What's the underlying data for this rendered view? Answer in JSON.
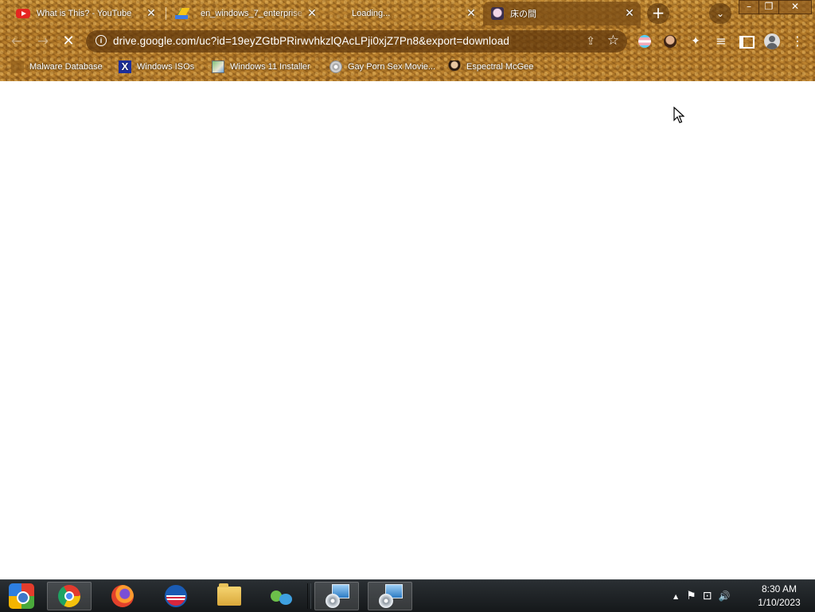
{
  "tabs": [
    {
      "title": "What is This? - YouTube",
      "icon": "youtube-icon"
    },
    {
      "title": "en_windows_7_enterprise",
      "icon": "google-drive-icon"
    },
    {
      "title": "Loading...",
      "icon": "loading-icon"
    },
    {
      "title": "床の間",
      "icon": "anime-favicon-icon"
    }
  ],
  "tab_close_symbol": "✕",
  "new_tab_symbol": "+",
  "tab_search_symbol": "⌄",
  "window_controls": {
    "minimize": "–",
    "restore": "❐",
    "close": "✕"
  },
  "toolbar": {
    "back": "←",
    "forward": "→",
    "stop": "✕",
    "info": "i",
    "url": "drive.google.com/uc?id=19eyZGtbPRirwvhkzlQAcLPji0xjZ7Pn8&export=download",
    "share": "⇪",
    "bookmark_star": "☆",
    "extensions_symbol": "✦",
    "media_symbol": "≡",
    "menu_symbol": "⋮"
  },
  "bookmarks": [
    {
      "label": "Malware Database",
      "icon": "bookmark-icon"
    },
    {
      "label": "Windows ISOs",
      "icon": "x-logo-icon"
    },
    {
      "label": "Windows 11 Installer",
      "icon": "windows-image-icon"
    },
    {
      "label": "Gay Porn Sex Movie...",
      "icon": "cd-icon"
    },
    {
      "label": "Espectral McGee",
      "icon": "avatar-icon"
    }
  ],
  "taskbar": {
    "clock_time": "8:30 AM",
    "clock_date": "1/10/2023",
    "tray_expand": "▲",
    "tray_flag": "⚑",
    "tray_network": "⊡",
    "tray_volume": "🔊"
  }
}
